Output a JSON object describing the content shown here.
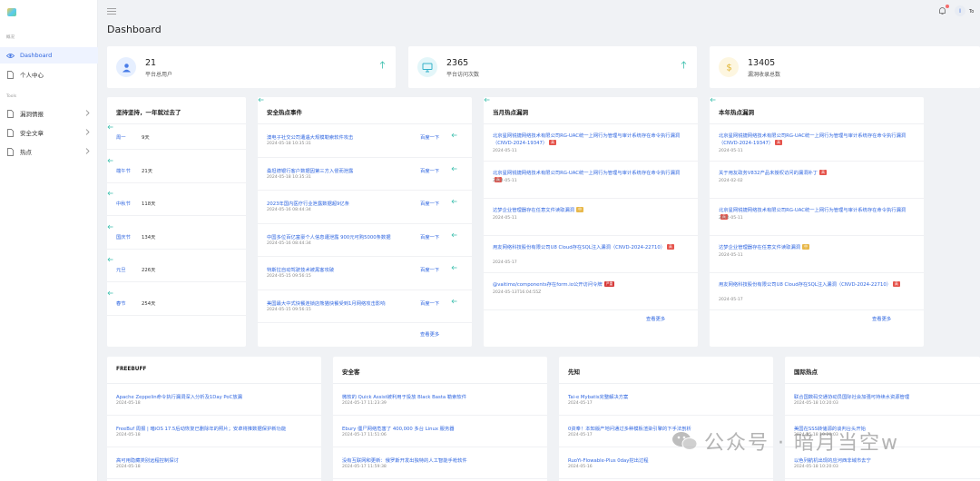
{
  "app": {
    "page_title": "Dashboard",
    "user_name": "To"
  },
  "sidebar": {
    "group1": "概况",
    "group2": "Tools",
    "items": [
      {
        "label": "Dashboard",
        "icon": "eye-icon",
        "active": true
      },
      {
        "label": "个人中心",
        "icon": "document-icon"
      },
      {
        "label": "漏洞情报",
        "icon": "document-icon"
      },
      {
        "label": "安全文章",
        "icon": "document-icon"
      },
      {
        "label": "热点",
        "icon": "document-icon"
      }
    ]
  },
  "stats": [
    {
      "value": "21",
      "label": "平台总用户",
      "icon": "user-icon",
      "color": "#4a7de8",
      "bg": "#e6efff"
    },
    {
      "value": "2365",
      "label": "平台访问次数",
      "icon": "monitor-icon",
      "color": "#36b1c9",
      "bg": "#e3f6f9"
    },
    {
      "value": "13405",
      "label": "漏洞收录总数",
      "icon": "dollar-icon",
      "color": "#e0b431",
      "bg": "#fdf6e0"
    }
  ],
  "holidays": {
    "title": "坚持坚持，一年就过去了",
    "items": [
      {
        "name": "周一",
        "days": "9天"
      },
      {
        "name": "端午节",
        "days": "21天"
      },
      {
        "name": "中秋节",
        "days": "118天"
      },
      {
        "name": "国庆节",
        "days": "134天"
      },
      {
        "name": "元旦",
        "days": "226天"
      },
      {
        "name": "春节",
        "days": "254天"
      }
    ]
  },
  "events": {
    "title": "安全热点事件",
    "action": "百度一下",
    "more": "查看更多",
    "items": [
      {
        "title": "澳电子社交公司遭遇大规模勒索软件攻击",
        "date": "2024-05-18 10:35:31"
      },
      {
        "title": "桑坦德银行客户数据因第三方入侵而泄露",
        "date": "2024-05-18 10:35:31"
      },
      {
        "title": "2023年国内医疗行业泄露数据超9亿条",
        "date": "2024-05-16 08:44:34"
      },
      {
        "title": "中国多位百亿富豪个人信息遭泄露 900元可购5000条数据",
        "date": "2024-05-16 08:44:34"
      },
      {
        "title": "特斯拉自动驾驶技术被黑客攻破",
        "date": "2024-05-15 09:56:15"
      },
      {
        "title": "美国最大中式快餐连锁店熊猫快餐受到1月网络攻击影响",
        "date": "2024-05-15 09:56:15"
      }
    ]
  },
  "monthly": {
    "title": "当月热点漏洞",
    "more": "查看更多",
    "items": [
      {
        "title": "北京星网锐捷网络技术有限公司RG-UAC统一上网行为管理与审计系统存在命令执行漏洞（CNVD-2024-19347）",
        "tag": "高",
        "tag_color": "#e5534b",
        "date": "2024-05-11"
      },
      {
        "title": "北京星网锐捷网络技术有限公司RG-UAC统一上网行为管理与审计系统存在命令执行漏洞",
        "tag": "高",
        "tag_color": "#e5534b",
        "date": "2024-05-11"
      },
      {
        "title": "达梦企业管理器存在任意文件读取漏洞",
        "tag": "中",
        "tag_color": "#e8b84a",
        "date": "2024-05-11"
      },
      {
        "title": "用友网络科技股份有限公司U8 Cloud存在SQL注入漏洞（CNVD-2024-22710）",
        "tag": "高",
        "tag_color": "#e5534b",
        "date": "2024-05-17"
      },
      {
        "title": "@vaitimo/components存在form.io公开访问令牌",
        "tag": "严重",
        "tag_color": "#d63a3a",
        "date": "2024-05-13T16:04:55Z"
      }
    ]
  },
  "yearly": {
    "title": "本年热点漏洞",
    "more": "查看更多",
    "items": [
      {
        "title": "北京星网锐捷网络技术有限公司RG-UAC统一上网行为管理与审计系统存在命令执行漏洞（CNVD-2024-19347）",
        "tag": "高",
        "tag_color": "#e5534b",
        "date": "2024-05-11"
      },
      {
        "title": "关于用友政务V832产品未授权访问的漏洞补丁",
        "tag": "高",
        "tag_color": "#e5534b",
        "date": "2024-02-02"
      },
      {
        "title": "北京星网锐捷网络技术有限公司RG-UAC统一上网行为管理与审计系统存在命令执行漏洞",
        "tag": "高",
        "tag_color": "#e5534b",
        "date": "2024-05-11"
      },
      {
        "title": "达梦企业管理器存在任意文件读取漏洞",
        "tag": "中",
        "tag_color": "#e8b84a",
        "date": "2024-05-11"
      },
      {
        "title": "用友网络科技股份有限公司U8 Cloud存在SQL注入漏洞（CNVD-2024-22710）",
        "tag": "高",
        "tag_color": "#e5534b",
        "date": "2024-05-17"
      }
    ]
  },
  "feeds": [
    {
      "title": "FREEBUFF",
      "items": [
        {
          "title": "Apache Zeppelin命令执行漏洞深入分析及1Day PoC放漏",
          "date": "2024-05-18"
        },
        {
          "title": "FreeBuf 周报 | 暗iOS 17.5后动恢复已删除年的照片；安卓将推数据保护新功能",
          "date": "2024-05-18"
        },
        {
          "title": "高可用隐藏类别远程控制探讨",
          "date": "2024-05-18"
        }
      ]
    },
    {
      "title": "安全客",
      "items": [
        {
          "title": "微软的 Quick Assist被利用于投放 Black Basta 勒索软件",
          "date": "2024-05-17 11:23:39"
        },
        {
          "title": "Ebury 僵尸网络危害了 400,000 多台 Linux 服务器",
          "date": "2024-05-17 11:51:06"
        },
        {
          "title": "没有互联网和更新：俄罗斯开发出独特的人工智能手枪软件",
          "date": "2024-05-17 11:59:38"
        }
      ]
    },
    {
      "title": "先知",
      "items": [
        {
          "title": "Tai-e Mybatis完整解决方案",
          "date": "2024-05-17"
        },
        {
          "title": "0资奉！本知版产地问通过多种模板渲染引擎的下手法剖析",
          "date": "2024-05-17"
        },
        {
          "title": "RuoYi-Flowable-Plus 0day挖出过程",
          "date": "2024-05-16"
        }
      ]
    },
    {
      "title": "国际热点",
      "items": [
        {
          "title": "联合国数码交通协动员国际社会加强可持续水资源管理",
          "date": "2024-05-18 10:20:03"
        },
        {
          "title": "美国在SSS转储源的谈判台头开始",
          "date": "2024-05-18 10:20:03"
        },
        {
          "title": "以色列航机出现的应河西非域市去宁",
          "date": "2024-05-18 10:20:03"
        }
      ]
    }
  ],
  "watermark": "公众号 · 暗月当空w"
}
